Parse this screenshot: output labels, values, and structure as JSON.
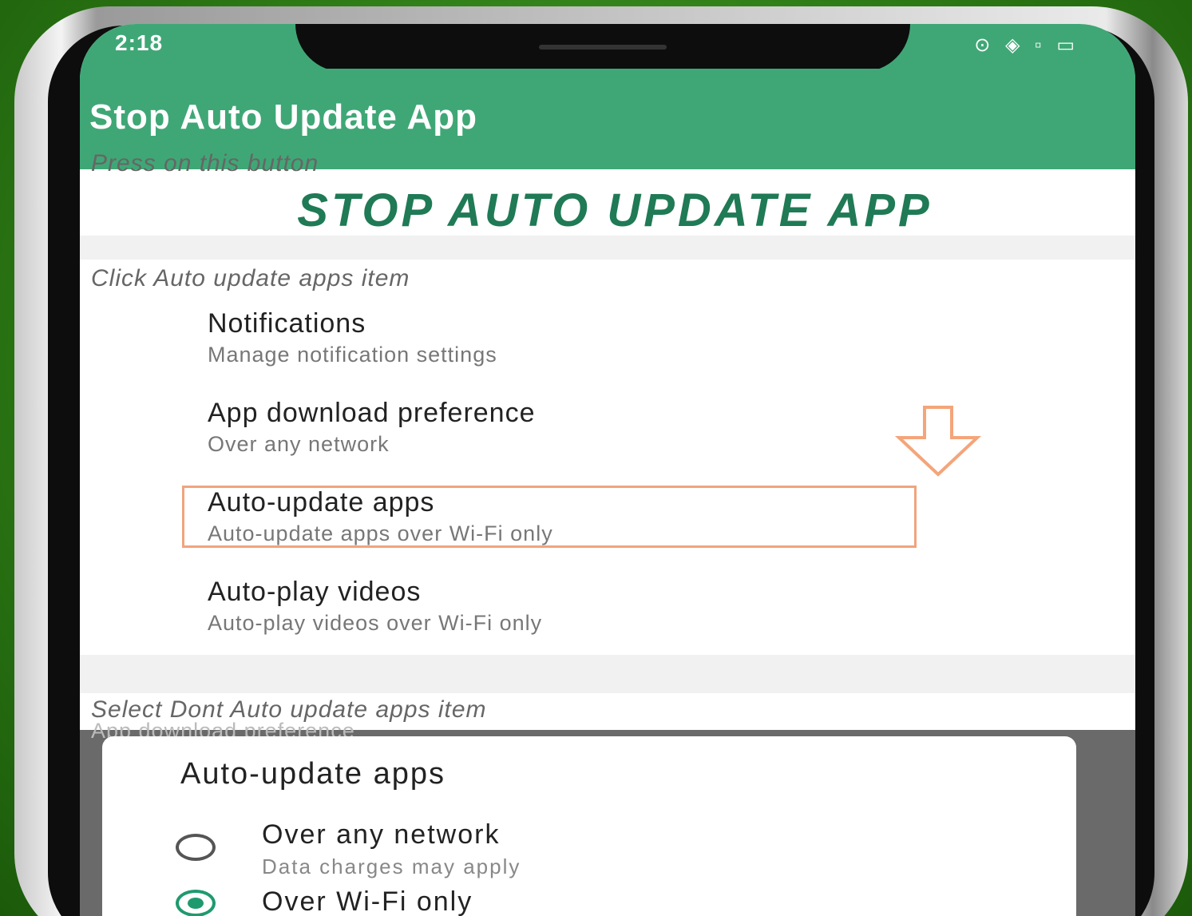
{
  "status_bar": {
    "time": "2:18",
    "icons": "⊙ ◈ ▫ ▭"
  },
  "app_bar": {
    "title": "Stop Auto Update App"
  },
  "step1": {
    "instruction": "Press on this button",
    "button_label": "STOP AUTO UPDATE APP"
  },
  "step2": {
    "instruction": "Click Auto update apps item",
    "items": [
      {
        "title": "Notifications",
        "subtitle": "Manage notification settings"
      },
      {
        "title": "App download preference",
        "subtitle": "Over any network"
      },
      {
        "title": "Auto-update apps",
        "subtitle": "Auto-update apps over Wi-Fi only"
      },
      {
        "title": "Auto-play videos",
        "subtitle": "Auto-play videos over Wi-Fi only"
      }
    ]
  },
  "step3": {
    "instruction": "Select Dont Auto update apps item",
    "background_text": "App download preference"
  },
  "dialog": {
    "title": "Auto-update apps",
    "options": [
      {
        "label": "Over any network",
        "subtitle": "Data charges may apply",
        "selected": false
      },
      {
        "label": "Over Wi-Fi only",
        "subtitle": "",
        "selected": true
      }
    ]
  },
  "colors": {
    "primary": "#3fa776",
    "button_text": "#1f7a55",
    "highlight": "#f0a47e",
    "arrow": "#f4a57a",
    "radio_checked": "#1f9a6e"
  },
  "icons": {
    "arrow": "down-arrow-icon"
  }
}
